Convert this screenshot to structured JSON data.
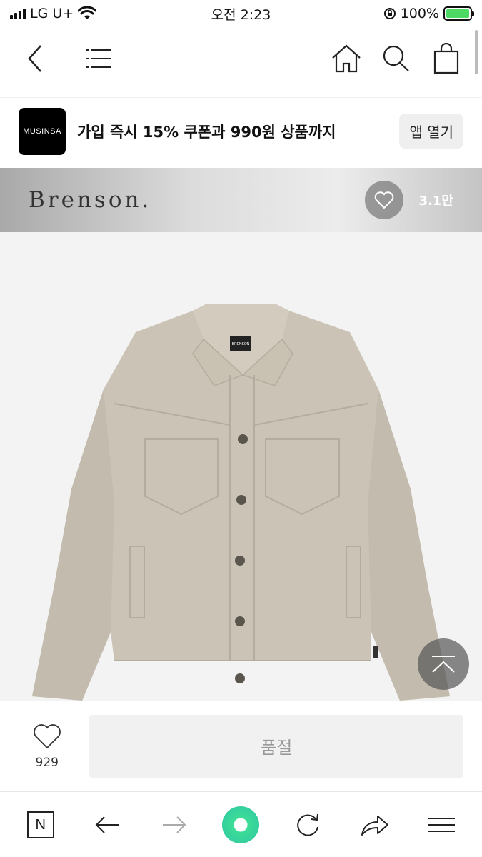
{
  "status_bar": {
    "carrier": "LG U+",
    "time": "오전 2:23",
    "battery": "100%",
    "battery_level": 1.0
  },
  "top_nav": {
    "icons": [
      "back-icon",
      "menu-icon",
      "home-icon",
      "search-icon",
      "cart-icon"
    ]
  },
  "promo": {
    "logo_text": "MUSINSA",
    "text": "가입 즉시 15% 쿠폰과 990원 상품까지",
    "button": "앱 열기"
  },
  "brand": {
    "name": "Brenson.",
    "likes": "3.1만"
  },
  "product": {
    "label_text": "BRENSON"
  },
  "action_bar": {
    "like_count": "929",
    "status_button": "품절"
  },
  "browser_bar": {
    "n_label": "N",
    "icons": [
      "naver-n-icon",
      "back-arrow-icon",
      "forward-arrow-icon",
      "green-dot-icon",
      "refresh-icon",
      "share-icon",
      "hamburger-icon"
    ]
  },
  "colors": {
    "brand_header_gradient": "#dcdcdc",
    "jacket": "#cbc3b5",
    "green_dot": "#3ddc97"
  }
}
